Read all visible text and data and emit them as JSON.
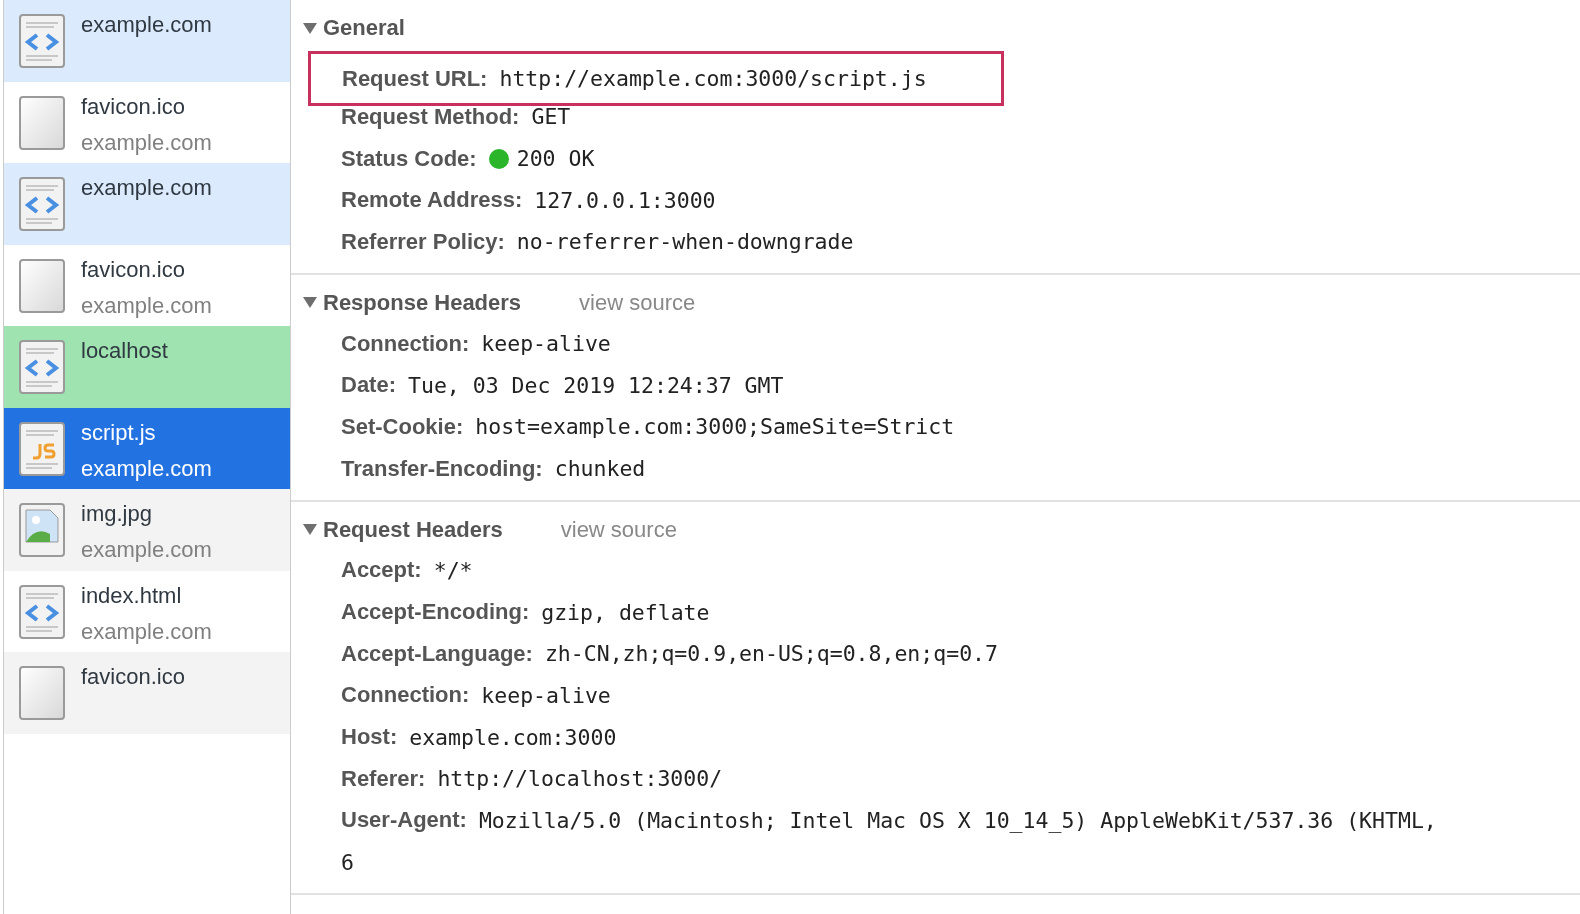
{
  "requests": [
    {
      "name": "example.com",
      "kind": "html",
      "selected": false,
      "color": "#dbeafd"
    },
    {
      "name": "favicon.ico",
      "domain": "example.com",
      "kind": "blank",
      "selected": false,
      "color": "#ffffff"
    },
    {
      "name": "example.com",
      "kind": "html",
      "selected": false,
      "color": "#dbeafd"
    },
    {
      "name": "favicon.ico",
      "domain": "example.com",
      "kind": "blank",
      "selected": false,
      "color": "#ffffff"
    },
    {
      "name": "localhost",
      "kind": "html",
      "selected": false,
      "color": "#9ee3b0"
    },
    {
      "name": "script.js",
      "domain": "example.com",
      "kind": "js",
      "selected": true,
      "color": "#2372e2"
    },
    {
      "name": "img.jpg",
      "domain": "example.com",
      "kind": "image",
      "selected": false,
      "color": "#f3f3f3"
    },
    {
      "name": "index.html",
      "domain": "example.com",
      "kind": "html",
      "selected": false,
      "color": "#ffffff"
    },
    {
      "name": "favicon.ico",
      "kind": "blank",
      "selected": false,
      "color": "#f3f3f3"
    }
  ],
  "sections": [
    {
      "title": "General",
      "expanded": true,
      "fields": [
        {
          "name": "Request URL:",
          "value": "http://example.com:3000/script.js",
          "outlined": true
        },
        {
          "name": "Request Method:",
          "value": "GET",
          "outlined": false
        },
        {
          "name": "Status Code:",
          "value": "200 OK",
          "color": "#2bb52b",
          "outlined": false
        },
        {
          "name": "Remote Address:",
          "value": "127.0.0.1:3000",
          "outlined": false
        },
        {
          "name": "Referrer Policy:",
          "value": "no-referrer-when-downgrade",
          "outlined": false
        }
      ]
    },
    {
      "title": "Response Headers",
      "expanded": true,
      "view_source": "view source",
      "fields": [
        {
          "name": "Connection:",
          "value": "keep-alive",
          "outlined": false
        },
        {
          "name": "Date:",
          "value": "Tue, 03 Dec 2019 12:24:37 GMT",
          "outlined": false
        },
        {
          "name": "Set-Cookie:",
          "value": "host=example.com:3000;SameSite=Strict",
          "outlined": false
        },
        {
          "name": "Transfer-Encoding:",
          "value": "chunked",
          "outlined": false
        }
      ]
    },
    {
      "title": "Request Headers",
      "expanded": true,
      "view_source": "view source",
      "fields": [
        {
          "name": "Accept:",
          "value": "*/*",
          "outlined": false
        },
        {
          "name": "Accept-Encoding:",
          "value": "gzip, deflate",
          "outlined": false
        },
        {
          "name": "Accept-Language:",
          "value": "zh-CN,zh;q=0.9,en-US;q=0.8,en;q=0.7",
          "outlined": false
        },
        {
          "name": "Connection:",
          "value": "keep-alive",
          "outlined": false
        },
        {
          "name": "Host:",
          "value": "example.com:3000",
          "outlined": false
        },
        {
          "name": "Referer:",
          "value": "http://localhost:3000/",
          "outlined": false
        },
        {
          "name": "User-Agent:",
          "value": "Mozilla/5.0 (Macintosh; Intel Mac OS X 10_14_5) AppleWebKit/537.36 (KHTML,",
          "continuation": "6",
          "outlined": false
        }
      ]
    }
  ]
}
